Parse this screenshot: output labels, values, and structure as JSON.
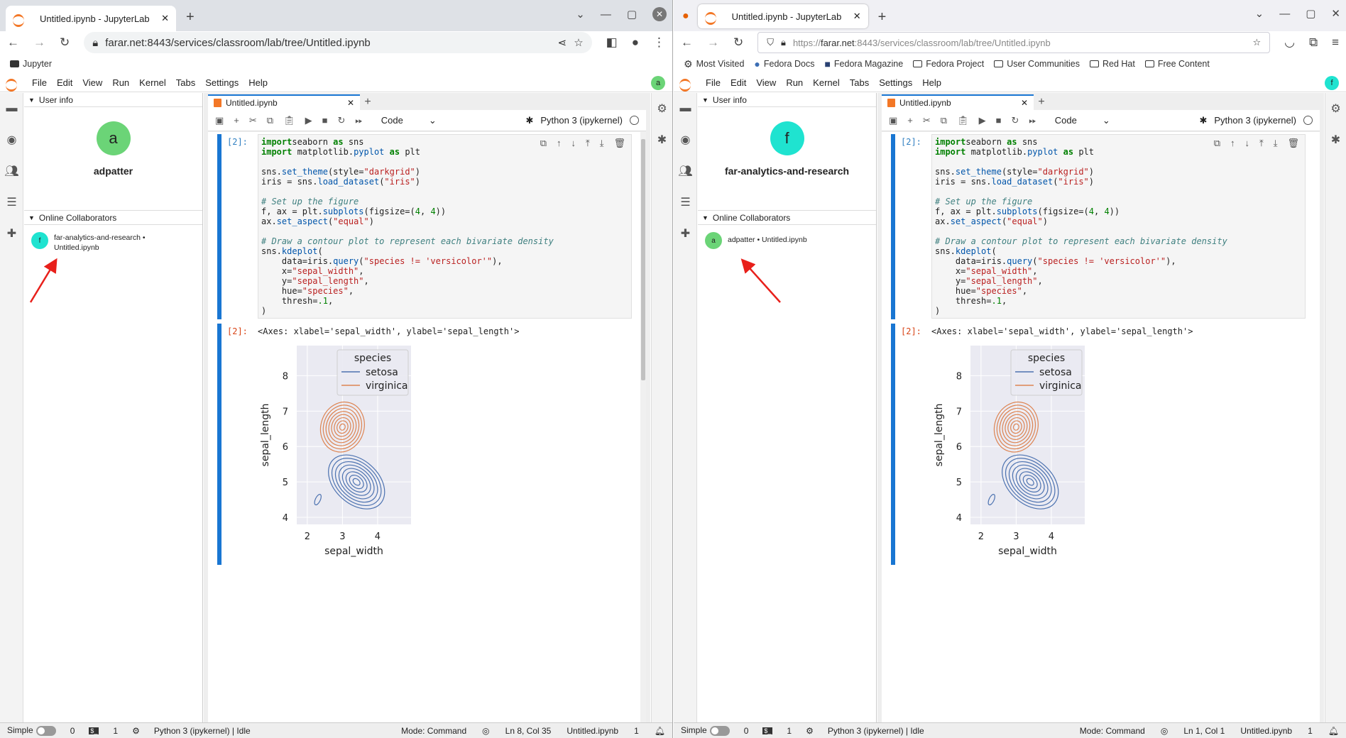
{
  "left": {
    "tab_title": "Untitled.ipynb - JupyterLab",
    "url": "farar.net:8443/services/classroom/lab/tree/Untitled.ipynb",
    "bookmark": "Jupyter",
    "menu": [
      "File",
      "Edit",
      "View",
      "Run",
      "Kernel",
      "Tabs",
      "Settings",
      "Help"
    ],
    "user_avatar_letter": "a",
    "user_info_title": "User info",
    "user_name": "adpatter",
    "collaborators_title": "Online Collaborators",
    "collaborator_letter": "f",
    "collaborator_text": "far-analytics-and-research • Untitled.ipynb",
    "doc_tab": "Untitled.ipynb",
    "cell_type": "Code",
    "kernel": "Python 3 (ipykernel)",
    "prompt_in": "[2]:",
    "prompt_out": "[2]:",
    "output_text": "<Axes: xlabel='sepal_width', ylabel='sepal_length'>",
    "status": {
      "mode_label": "Simple",
      "count1": "0",
      "count2": "1",
      "kernel_status": "Python 3 (ipykernel) | Idle",
      "mode": "Mode: Command",
      "cursor": "Ln 8, Col 35",
      "file": "Untitled.ipynb",
      "notif": "1"
    }
  },
  "right": {
    "tab_title": "Untitled.ipynb - JupyterLab",
    "url_prefix": "https://",
    "url_host": "farar.net",
    "url_rest": ":8443/services/classroom/lab/tree/Untitled.ipynb",
    "bookmarks": [
      "Most Visited",
      "Fedora Docs",
      "Fedora Magazine",
      "Fedora Project",
      "User Communities",
      "Red Hat",
      "Free Content"
    ],
    "menu": [
      "File",
      "Edit",
      "View",
      "Run",
      "Kernel",
      "Tabs",
      "Settings",
      "Help"
    ],
    "user_avatar_letter": "f",
    "user_info_title": "User info",
    "user_name": "far-analytics-and-research",
    "collaborators_title": "Online Collaborators",
    "collaborator_letter": "a",
    "collaborator_text": "adpatter • Untitled.ipynb",
    "doc_tab": "Untitled.ipynb",
    "cell_type": "Code",
    "kernel": "Python 3 (ipykernel)",
    "prompt_in": "[2]:",
    "prompt_out": "[2]:",
    "output_text": "<Axes: xlabel='sepal_width', ylabel='sepal_length'>",
    "status": {
      "mode_label": "Simple",
      "count1": "0",
      "count2": "1",
      "kernel_status": "Python 3 (ipykernel) | Idle",
      "mode": "Mode: Command",
      "cursor": "Ln 1, Col 1",
      "file": "Untitled.ipynb",
      "notif": "1"
    }
  },
  "code_lines": [
    [
      [
        "kw",
        "import"
      ],
      [
        "",
        "seaborn "
      ],
      [
        "kw",
        "as"
      ],
      [
        "",
        " sns"
      ]
    ],
    [
      [
        "kw",
        "import"
      ],
      [
        "",
        " matplotlib."
      ],
      [
        "fn",
        "pyplot"
      ],
      [
        "",
        " "
      ],
      [
        "kw",
        "as"
      ],
      [
        "",
        " plt"
      ]
    ],
    [],
    [
      [
        "",
        "sns."
      ],
      [
        "fn",
        "set_theme"
      ],
      [
        "",
        "(style="
      ],
      [
        "st",
        "\"darkgrid\""
      ],
      [
        "",
        ")"
      ]
    ],
    [
      [
        "",
        "iris = sns."
      ],
      [
        "fn",
        "load_dataset"
      ],
      [
        "",
        "("
      ],
      [
        "st",
        "\"iris\""
      ],
      [
        "",
        ")"
      ]
    ],
    [],
    [
      [
        "cm",
        "# Set up the figure"
      ]
    ],
    [
      [
        "",
        "f, ax = plt."
      ],
      [
        "fn",
        "subplots"
      ],
      [
        "",
        "(figsize=("
      ],
      [
        "nm",
        "4"
      ],
      [
        "",
        ", "
      ],
      [
        "nm",
        "4"
      ],
      [
        "",
        "))"
      ]
    ],
    [
      [
        "",
        "ax."
      ],
      [
        "fn",
        "set_aspect"
      ],
      [
        "",
        "("
      ],
      [
        "st",
        "\"equal\""
      ],
      [
        "",
        ")"
      ]
    ],
    [],
    [
      [
        "cm",
        "# Draw a contour plot to represent each bivariate density"
      ]
    ],
    [
      [
        "",
        "sns."
      ],
      [
        "fn",
        "kdeplot"
      ],
      [
        "",
        "("
      ]
    ],
    [
      [
        "",
        "    data=iris."
      ],
      [
        "fn",
        "query"
      ],
      [
        "",
        "("
      ],
      [
        "st",
        "\"species != 'versicolor'\""
      ],
      [
        "",
        "),"
      ]
    ],
    [
      [
        "",
        "    x="
      ],
      [
        "st",
        "\"sepal_width\""
      ],
      [
        "",
        ","
      ]
    ],
    [
      [
        "",
        "    y="
      ],
      [
        "st",
        "\"sepal_length\""
      ],
      [
        "",
        ","
      ]
    ],
    [
      [
        "",
        "    hue="
      ],
      [
        "st",
        "\"species\""
      ],
      [
        "",
        ","
      ]
    ],
    [
      [
        "",
        "    thresh="
      ],
      [
        "nm",
        ".1"
      ],
      [
        "",
        ","
      ]
    ],
    [
      [
        "",
        ")"
      ]
    ]
  ],
  "chart_data": {
    "type": "contour",
    "xlabel": "sepal_width",
    "ylabel": "sepal_length",
    "xlim": [
      1.7,
      4.95
    ],
    "ylim": [
      3.8,
      8.85
    ],
    "xticks": [
      2,
      3,
      4
    ],
    "yticks": [
      4,
      5,
      6,
      7,
      8
    ],
    "grid": true,
    "legend_title": "species",
    "legend_position": "top-right",
    "series": [
      {
        "name": "setosa",
        "color": "#4c72b0",
        "center": [
          3.4,
          5.0
        ]
      },
      {
        "name": "virginica",
        "color": "#dd8452",
        "center": [
          3.0,
          6.55
        ]
      }
    ]
  },
  "colors": {
    "accent": "#1976d2",
    "jupyter_orange": "#f37726",
    "setosa": "#4c72b0",
    "virginica": "#dd8452",
    "arrow": "#e8201b"
  }
}
